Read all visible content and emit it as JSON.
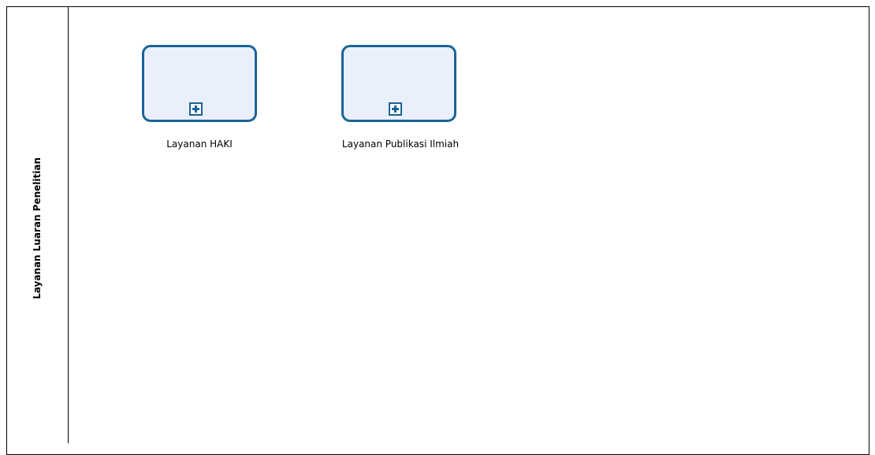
{
  "diagram": {
    "lane": {
      "title": "Layanan Luaran Penelitian"
    },
    "tasks": [
      {
        "label": "Layanan HAKI",
        "marker": "plus-icon"
      },
      {
        "label": "Layanan Publikasi Ilmiah",
        "marker": "plus-icon"
      }
    ]
  },
  "colors": {
    "task_border": "#1a6496",
    "task_fill": "#eaf0fb",
    "lane_line": "#000000"
  }
}
